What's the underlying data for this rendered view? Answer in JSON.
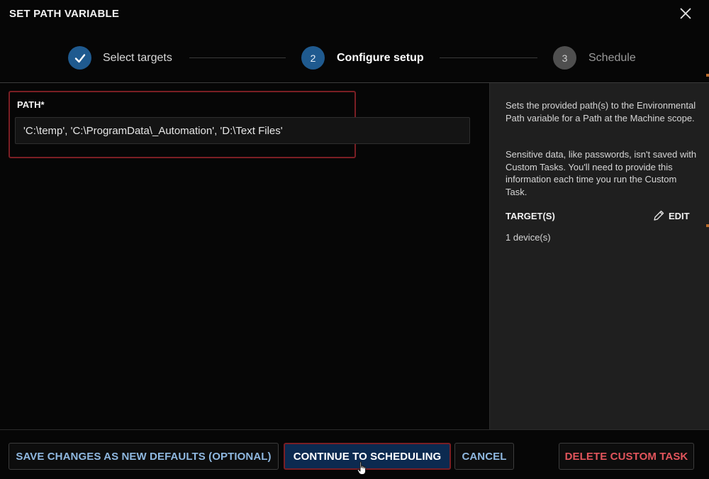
{
  "dialog": {
    "title": "SET PATH VARIABLE",
    "close_icon": "close-icon"
  },
  "stepper": {
    "steps": [
      {
        "number": "",
        "label": "Select targets",
        "state": "completed",
        "icon": "check-icon"
      },
      {
        "number": "2",
        "label": "Configure setup",
        "state": "active"
      },
      {
        "number": "3",
        "label": "Schedule",
        "state": "pending"
      }
    ]
  },
  "form": {
    "path_label": "PATH*",
    "path_value": "'C:\\temp', 'C:\\ProgramData\\_Automation', 'D:\\Text Files'"
  },
  "side_panel": {
    "description_1": "Sets the provided path(s) to the Environmental Path variable for a Path at the Machine scope.",
    "description_2": "Sensitive data, like passwords, isn't saved with Custom Tasks. You'll need to provide this information each time you run the Custom Task.",
    "targets_heading": "TARGET(S)",
    "edit_label": "EDIT",
    "edit_icon": "pencil-icon",
    "device_count": "1 device(s)"
  },
  "footer": {
    "save_defaults_label": "SAVE CHANGES AS NEW DEFAULTS (OPTIONAL)",
    "continue_label": "CONTINUE TO SCHEDULING",
    "cancel_label": "CANCEL",
    "delete_label": "DELETE CUSTOM TASK"
  },
  "colors": {
    "accent_blue": "#1f5a8f",
    "highlight_red": "#7a1e24",
    "link_blue": "#8fb8e0",
    "danger_red": "#e2555c",
    "panel_bg": "#1f1f1f",
    "step_pending": "#4f4f4f"
  }
}
